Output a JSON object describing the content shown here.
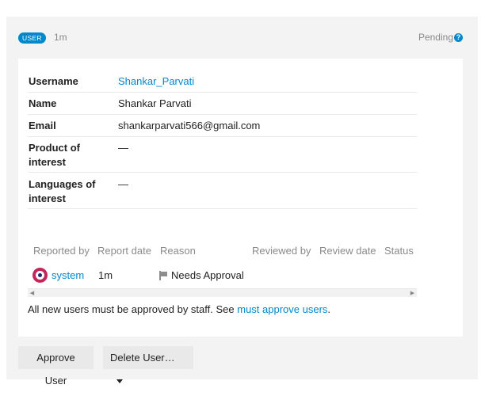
{
  "header": {
    "badge": "USER",
    "age": "1m",
    "status": "Pending",
    "help_icon": "question-circle-icon"
  },
  "details": {
    "username_label": "Username",
    "username_value": "Shankar_Parvati",
    "name_label": "Name",
    "name_value": "Shankar Parvati",
    "email_label": "Email",
    "email_value": "shankarparvati566@gmail.com",
    "product_label_1": "Product of",
    "product_label_2": "interest",
    "product_value": "—",
    "languages_label_1": "Languages of",
    "languages_label_2": "interest",
    "languages_value": "—"
  },
  "reports": {
    "headers": [
      "Reported by",
      "Report date",
      "Reason",
      "Reviewed by",
      "Review date",
      "Status"
    ],
    "row": {
      "reporter": "system",
      "reporter_icon": "system-avatar-icon",
      "date": "1m",
      "reason_icon": "flag-icon",
      "reason": "Needs Approval"
    }
  },
  "note": {
    "text": "All new users must be approved by staff. See ",
    "link": "must approve users",
    "end": "."
  },
  "actions": {
    "approve": "Approve User",
    "delete": "Delete User…"
  },
  "colors": {
    "accent": "#0088cc",
    "card_bg": "#f3f3f3",
    "muted": "#888888"
  }
}
